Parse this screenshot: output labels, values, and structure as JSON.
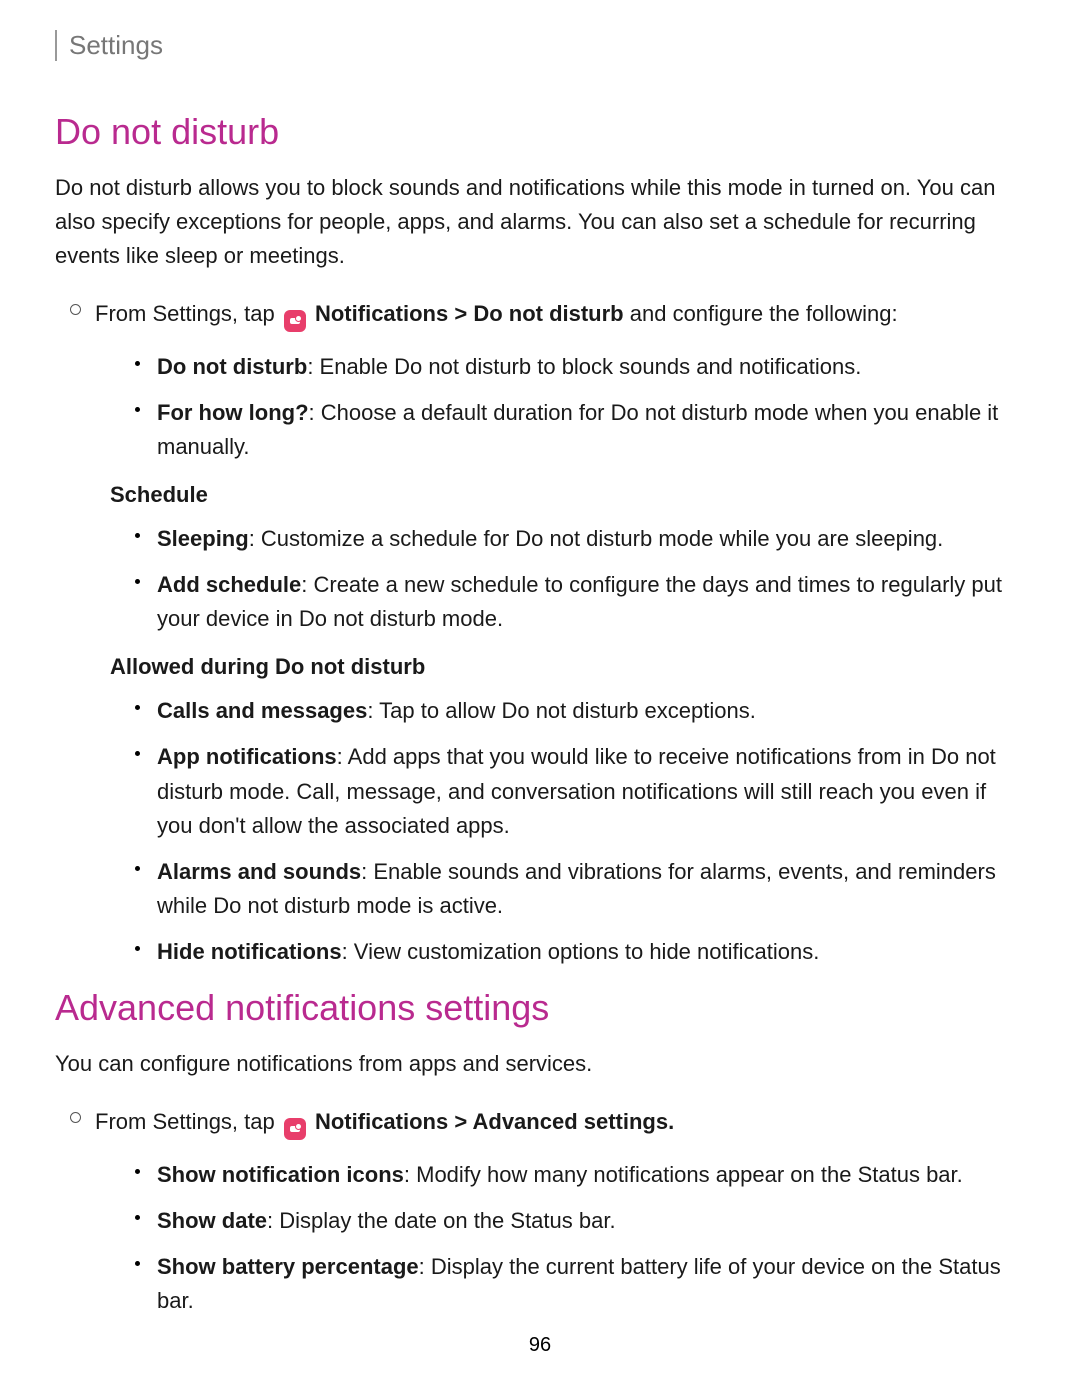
{
  "header": {
    "title": "Settings"
  },
  "section1": {
    "heading": "Do not disturb",
    "intro": "Do not disturb allows you to block sounds and notifications while this mode in turned on. You can also specify exceptions for people, apps, and alarms. You can also set a schedule for recurring events like sleep or meetings.",
    "nav": {
      "prefix": "From Settings, tap ",
      "notifications": "Notifications",
      "dnd": "Do not disturb",
      "suffix": " and configure the following:"
    },
    "items": [
      {
        "label": "Do not disturb",
        "text": ": Enable Do not disturb to block sounds and notifications."
      },
      {
        "label": "For how long?",
        "text": ": Choose a default duration for Do not disturb mode when you enable it manually."
      }
    ],
    "sub1_header": "Schedule",
    "sub1_items": [
      {
        "label": "Sleeping",
        "text": ": Customize a schedule for Do not disturb mode while you are sleeping."
      },
      {
        "label": "Add schedule",
        "text": ": Create a new schedule to configure the days and times to regularly put your device in Do not disturb mode."
      }
    ],
    "sub2_header": "Allowed during Do not disturb",
    "sub2_items": [
      {
        "label": "Calls and messages",
        "text": ": Tap to allow Do not disturb exceptions."
      },
      {
        "label": "App notifications",
        "text": ": Add apps that you would like to receive notifications from in Do not disturb mode. Call, message, and conversation notifications will still reach you even if you don't allow the associated apps."
      },
      {
        "label": "Alarms and sounds",
        "text": ": Enable sounds and vibrations for alarms, events, and reminders while Do not disturb mode is active."
      },
      {
        "label": "Hide notifications",
        "text": ": View customization options to hide notifications."
      }
    ]
  },
  "section2": {
    "heading": "Advanced notifications settings",
    "intro": "You can configure notifications from apps and services.",
    "nav": {
      "prefix": "From Settings, tap ",
      "notifications": "Notifications",
      "advanced": "Advanced settings",
      "suffix": "."
    },
    "items": [
      {
        "label": "Show notification icons",
        "text": ": Modify how many notifications appear on the Status bar."
      },
      {
        "label": "Show date",
        "text": ": Display the date on the Status bar."
      },
      {
        "label": "Show battery percentage",
        "text": ": Display the current battery life of your device on the Status bar."
      }
    ]
  },
  "page_number": "96"
}
